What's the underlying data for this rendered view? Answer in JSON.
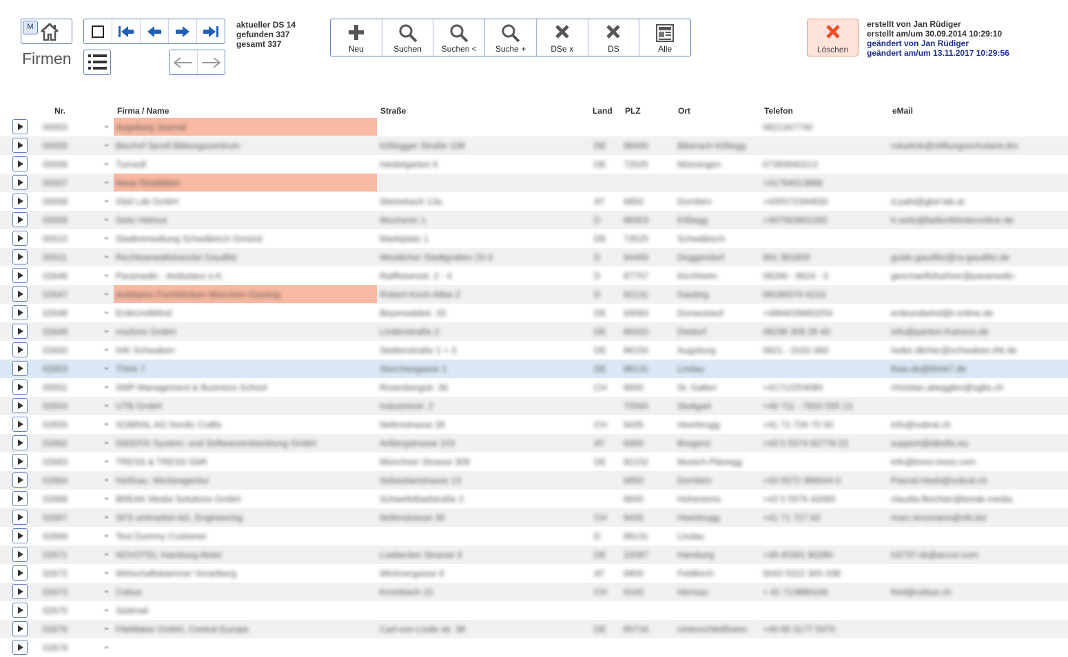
{
  "nav": {
    "m_label": "M",
    "page_title": "Firmen"
  },
  "status": {
    "current": "aktueller DS 14",
    "found": "gefunden 337",
    "total": "gesamt 337"
  },
  "toolbar": {
    "new_label": "Neu",
    "search_label": "Suchen",
    "search_narrow_label": "Suchen <",
    "search_extend_label": "Suche +",
    "exclude_label": "DSe x",
    "ds_label": "DS",
    "all_label": "Alle"
  },
  "delete_label": "Löschen",
  "meta": {
    "created_by": "erstellt von Jan Rüdiger",
    "created_at": "erstellt am/um 30.09.2014 10:29:10",
    "changed_by": "geändert von Jan Rüdiger",
    "changed_at": "geändert am/um 13.11.2017 10:29:56"
  },
  "table": {
    "headers": {
      "nr": "Nr.",
      "firma": "Firma / Name",
      "strasse": "Straße",
      "land": "Land",
      "plz": "PLZ",
      "ort": "Ort",
      "telefon": "Telefon",
      "email": "eMail"
    },
    "rows": [
      {
        "nr": "00003",
        "firma": "Augsburg Journal",
        "strasse": "",
        "land": "",
        "plz": "",
        "ort": "",
        "telefon": "0821347740",
        "email": "",
        "highlight": true
      },
      {
        "nr": "00005",
        "firma": "Bischof Sproll Bildungszentrum",
        "strasse": "Kißlegger Straße 108",
        "land": "DE",
        "plz": "88400",
        "ort": "Biberach Kißlegg",
        "telefon": "",
        "email": "rotuelcle@stiftungsschulamt.drs"
      },
      {
        "nr": "00006",
        "firma": "Turnedl",
        "strasse": "Heidelgarten 6",
        "land": "DE",
        "plz": "72525",
        "ort": "Münsingen",
        "telefon": "07383940213",
        "email": ""
      },
      {
        "nr": "00007",
        "firma": "Neue Realitäten",
        "strasse": "",
        "land": "",
        "plz": "",
        "ort": "",
        "telefon": "+41794013886",
        "email": "",
        "highlight": true
      },
      {
        "nr": "00008",
        "firma": "Gbd Lab GmbH",
        "strasse": "Steinebach 13a",
        "land": "AT",
        "plz": "6850",
        "ort": "Dornbirn",
        "telefon": "+435572394830",
        "email": "d.pahl@gbd-lab.at"
      },
      {
        "nr": "00009",
        "firma": "Seitz Helmut",
        "strasse": "Wucherer 1",
        "land": "D",
        "plz": "88353",
        "ort": "Kißlegg",
        "telefon": "+497563902282",
        "email": "h.seitz@bellonfelmteronline.de"
      },
      {
        "nr": "00010",
        "firma": "Stadtverwaltung Schwäbisch Gmünd",
        "strasse": "Marktplatz 1",
        "land": "DE",
        "plz": "73525",
        "ort": "Schwäbisch",
        "telefon": "",
        "email": ""
      },
      {
        "nr": "00011",
        "firma": "Rechtsanwaltskanzlei Gaudlitz",
        "strasse": "Westlicher Stadtgraben 24 d",
        "land": "D",
        "plz": "94469",
        "ort": "Deggendorf",
        "telefon": "991 381800",
        "email": "guido.gaudlitz@ra-gaudlitz.de"
      },
      {
        "nr": "02646",
        "firma": "Paramedic - Ambulanz e.K.",
        "strasse": "Raiffeisenstr. 2 - 4",
        "land": "D",
        "plz": "87757",
        "ort": "Kirchheim",
        "telefon": "08266 - 8624 - 0",
        "email": "geschaeftsfuehrer@paramedic-"
      },
      {
        "nr": "02647",
        "firma": "Asklepios Fachkliniken München-Gauting",
        "strasse": "Robert-Koch-Allee 2",
        "land": "D",
        "plz": "82131",
        "ort": "Gauting",
        "telefon": "08189370-4210",
        "email": "",
        "highlight": true
      },
      {
        "nr": "02648",
        "firma": "ErdeUndWind",
        "strasse": "Beyerwaldstr. 33",
        "land": "DE",
        "plz": "93093",
        "ort": "Donaustauf",
        "telefon": "+4994039683254",
        "email": "erdeundwind@t-online.de"
      },
      {
        "nr": "02649",
        "firma": "ma3oris GmbH",
        "strasse": "Lindenstraße 2",
        "land": "DE",
        "plz": "86420",
        "ort": "Diedorf",
        "telefon": "08238 308 28 40",
        "email": "info@panton-fruiness.de"
      },
      {
        "nr": "02650",
        "firma": "IHK Schwaben",
        "strasse": "Stettenstraße 1 + 3",
        "land": "DE",
        "plz": "86150",
        "ort": "Augsburg",
        "telefon": "0821 - 3162-360",
        "email": "heike.dilcher@schwaben.ihk.de"
      },
      {
        "nr": "02653",
        "firma": "Think 7",
        "strasse": "Storchengasse 1",
        "land": "DE",
        "plz": "88131",
        "ort": "Lindau",
        "telefon": "",
        "email": "thao.do@think7.de",
        "selected": true
      },
      {
        "nr": "00001",
        "firma": "SMP Management & Business School",
        "strasse": "Rosenbergstr. 36",
        "land": "CH",
        "plz": "9000",
        "ort": "St. Gallen",
        "telefon": "+41712254080",
        "email": "christian.abegglen@sgbs.ch"
      },
      {
        "nr": "02654",
        "firma": "UTB GmbH",
        "strasse": "Industriestr. 2",
        "land": "",
        "plz": "70565",
        "ort": "Stuttgart",
        "telefon": "+49 711 - 7820 555 13",
        "email": ""
      },
      {
        "nr": "02655",
        "firma": "SOBRAL AG Nordic Crafts",
        "strasse": "Nefenstrasse 28",
        "land": "CH",
        "plz": "9435",
        "ort": "Heerbrugg",
        "telefon": "+41 71-726 70 50",
        "email": "info@sobral.ch"
      },
      {
        "nr": "02662",
        "firma": "IDEEFIX System- und Softwareentwicklung GmbH",
        "strasse": "Arlbergstrasse 103",
        "land": "AT",
        "plz": "6900",
        "ort": "Bregenz",
        "telefon": "+43 5 5574 82779-22",
        "email": "support@ideefix.eu"
      },
      {
        "nr": "02663",
        "firma": "TRESS & TRESS GbR",
        "strasse": "Münchner Strasse 308",
        "land": "DE",
        "plz": "82152",
        "ort": "Munich-Planegg",
        "telefon": "",
        "email": "info@tress-tress.com"
      },
      {
        "nr": "02664",
        "firma": "Heißrau. Werbeagentur",
        "strasse": "Sebastianstrasse 13",
        "land": "",
        "plz": "6850",
        "ort": "Dornbirn",
        "telefon": "+43 5572 386644-0",
        "email": "Pascal.Heeb@sobral.ch"
      },
      {
        "nr": "02666",
        "firma": "BREAK Media Solutions GmbH",
        "strasse": "Schwefelbadstraße 2",
        "land": "",
        "plz": "6845",
        "ort": "Hohenems",
        "telefon": "+43 5 5576 42083",
        "email": "claudia.fleichter@break-media."
      },
      {
        "nr": "02667",
        "firma": "SFS unimarket AG, Engineering",
        "strasse": "Nefenstrasse 30",
        "land": "CH",
        "plz": "9435",
        "ort": "Heerbrugg",
        "telefon": "+41 71 727 63",
        "email": "marc.lenzmann@sfs.biz"
      },
      {
        "nr": "02669",
        "firma": "Test Dummy Customer",
        "strasse": "",
        "land": "D",
        "plz": "88131",
        "ort": "Lindau",
        "telefon": "",
        "email": ""
      },
      {
        "nr": "02671",
        "firma": "NOVOTEL Hamburg Alster",
        "strasse": "Luebecker Strasse 3",
        "land": "DE",
        "plz": "22087",
        "ort": "Hamburg",
        "telefon": "+49 40391 90280",
        "email": "h3737-sb@accor.com"
      },
      {
        "nr": "02672",
        "firma": "Wirtschaftskammer Vorarlberg",
        "strasse": "Wichnergasse 9",
        "land": "AT",
        "plz": "6800",
        "ort": "Feldkirch",
        "telefon": "0043 5522 305-338",
        "email": ""
      },
      {
        "nr": "02673",
        "firma": "Cebus",
        "strasse": "Krombach 15",
        "land": "CH",
        "plz": "9100",
        "ort": "Herisau",
        "telefon": "+ 41 713880106",
        "email": "fred@cebus.ch"
      },
      {
        "nr": "02675",
        "firma": "Südmail",
        "strasse": "",
        "land": "",
        "plz": "",
        "ort": "",
        "telefon": "",
        "email": ""
      },
      {
        "nr": "02676",
        "firma": "FileMaker GmbH, Central Europe",
        "strasse": "Carl-von-Linde str. 38",
        "land": "DE",
        "plz": "85716",
        "ort": "Unterschleißheim",
        "telefon": "+49 89 3177 5970",
        "email": ""
      },
      {
        "nr": "02679",
        "firma": "",
        "strasse": "",
        "land": "",
        "plz": "",
        "ort": "",
        "telefon": "",
        "email": ""
      }
    ]
  }
}
